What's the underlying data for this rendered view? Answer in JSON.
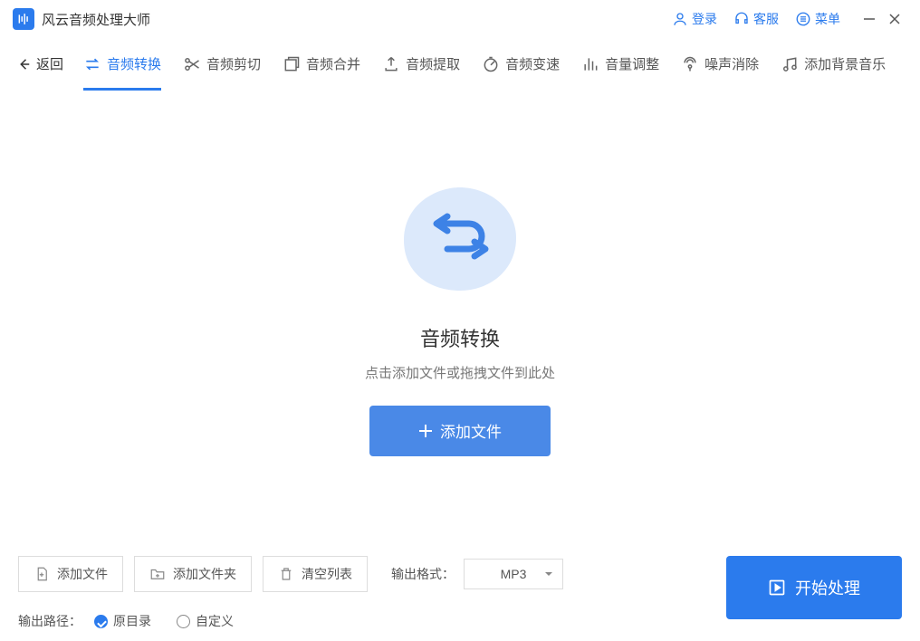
{
  "title_bar": {
    "app_title": "风云音频处理大师",
    "login": "登录",
    "support": "客服",
    "menu": "菜单"
  },
  "back_label": "返回",
  "tabs": [
    {
      "label": "音频转换"
    },
    {
      "label": "音频剪切"
    },
    {
      "label": "音频合并"
    },
    {
      "label": "音频提取"
    },
    {
      "label": "音频变速"
    },
    {
      "label": "音量调整"
    },
    {
      "label": "噪声消除"
    },
    {
      "label": "添加背景音乐"
    }
  ],
  "main": {
    "title": "音频转换",
    "subtitle": "点击添加文件或拖拽文件到此处",
    "add_file_label": "添加文件"
  },
  "bottom": {
    "add_file": "添加文件",
    "add_folder": "添加文件夹",
    "clear_list": "清空列表",
    "format_label": "输出格式：",
    "format_value": "MP3",
    "start_label": "开始处理",
    "output_label": "输出路径：",
    "radio_original": "原目录",
    "radio_custom": "自定义"
  }
}
